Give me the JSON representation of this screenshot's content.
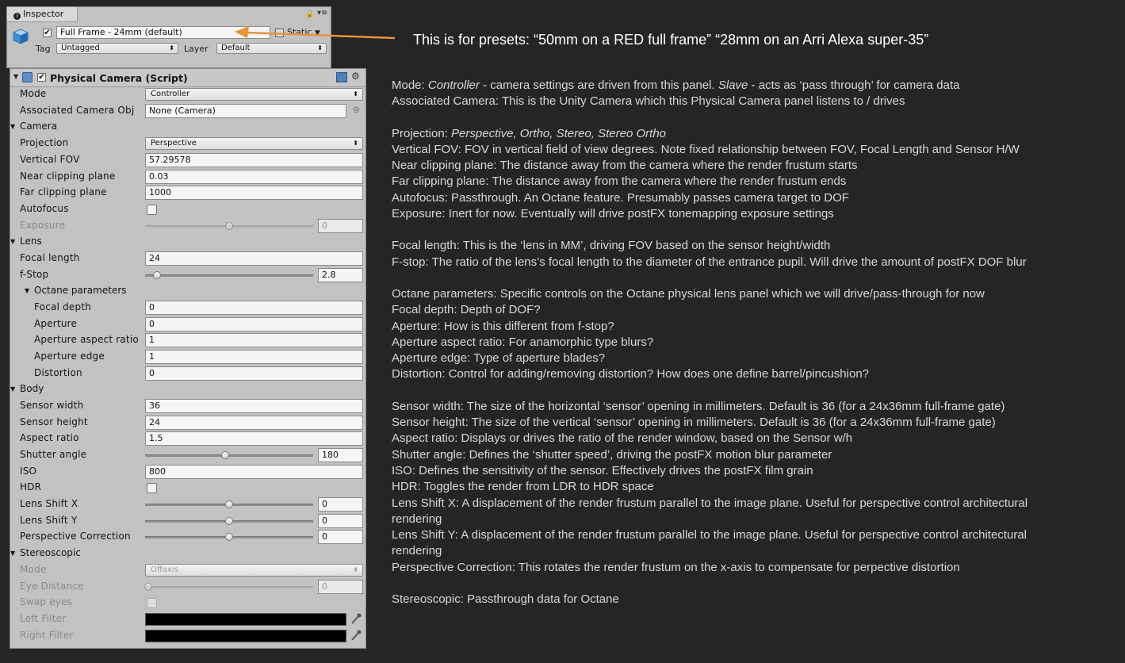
{
  "inspector": {
    "tab_label": "Inspector",
    "preset_name": "Full Frame - 24mm (default)",
    "preset_checked": true,
    "static_label": "Static",
    "tag_label": "Tag",
    "tag_value": "Untagged",
    "layer_label": "Layer",
    "layer_value": "Default"
  },
  "component": {
    "title": "Physical Camera (Script)",
    "mode_label": "Mode",
    "mode_value": "Controller",
    "assoc_label": "Associated Camera Obj",
    "assoc_value": "None (Camera)",
    "camera_section": "Camera",
    "projection_label": "Projection",
    "projection_value": "Perspective",
    "vfov_label": "Vertical FOV",
    "vfov_value": "57.29578",
    "near_label": "Near clipping plane",
    "near_value": "0.03",
    "far_label": "Far clipping plane",
    "far_value": "1000",
    "autofocus_label": "Autofocus",
    "exposure_label": "Exposure",
    "exposure_value": "0",
    "lens_section": "Lens",
    "focal_label": "Focal length",
    "focal_value": "24",
    "fstop_label": "f-Stop",
    "fstop_value": "2.8",
    "fstop_fraction": 0.05,
    "octane_section": "Octane parameters",
    "focal_depth_label": "Focal depth",
    "focal_depth_value": "0",
    "aperture_label": "Aperture",
    "aperture_value": "0",
    "aperture_ratio_label": "Aperture aspect ratio",
    "aperture_ratio_value": "1",
    "aperture_edge_label": "Aperture edge",
    "aperture_edge_value": "1",
    "distortion_label": "Distortion",
    "distortion_value": "0",
    "body_section": "Body",
    "sensor_w_label": "Sensor width",
    "sensor_w_value": "36",
    "sensor_h_label": "Sensor height",
    "sensor_h_value": "24",
    "aspect_label": "Aspect ratio",
    "aspect_value": "1.5",
    "shutter_label": "Shutter angle",
    "shutter_value": "180",
    "iso_label": "ISO",
    "iso_value": "800",
    "hdr_label": "HDR",
    "shiftx_label": "Lens Shift X",
    "shiftx_value": "0",
    "shifty_label": "Lens Shift Y",
    "shifty_value": "0",
    "persp_label": "Perspective Correction",
    "persp_value": "0",
    "stereo_section": "Stereoscopic",
    "stereo_mode_label": "Mode",
    "stereo_mode_value": "Offaxis",
    "eye_label": "Eye Distance",
    "eye_value": "0",
    "swap_label": "Swap eyes",
    "left_filter_label": "Left Filter",
    "right_filter_label": "Right Filter",
    "left_filter_color": "#000000",
    "right_filter_color": "#000000"
  },
  "annotation": {
    "arrow_color": "#e8923a",
    "preset_note": "This is for presets:  “50mm on a RED full frame” “28mm on an Arri Alexa super-35”",
    "mode_prefix": "Mode: ",
    "mode_controller": "Controller",
    "mode_mid": " - camera settings are driven from this panel.  ",
    "mode_slave": "Slave",
    "mode_suffix": " - acts as ‘pass through’ for camera data",
    "assoc": "Associated Camera: This is the Unity Camera which this Physical Camera panel listens to / drives",
    "proj_prefix": "Projection: ",
    "proj_values": "Perspective, Ortho, Stereo, Stereo Ortho",
    "vfov": "Vertical FOV:  FOV in vertical field of view degrees.  Note fixed relationship between FOV, Focal Length and Sensor H/W",
    "near": "Near clipping plane:  The distance away from the camera where the render frustum starts",
    "far": "Far clipping plane:  The distance away from the camera where the render frustum ends",
    "autofocus": "Autofocus:  Passthrough.  An Octane feature.  Presumably passes camera target to DOF",
    "exposure": "Exposure: Inert for now.  Eventually will drive postFX tonemapping exposure settings",
    "focal": "Focal length:  This is the ‘lens in MM’, driving FOV based on the sensor height/width",
    "fstop": "F-stop:  The ratio of the lens’s focal length to the diameter of the entrance pupil.  Will drive the amount of postFX DOF blur",
    "octane": "Octane parameters:  Specific controls on the Octane physical lens panel which we will drive/pass-through for now",
    "focal_depth": "Focal depth: Depth of DOF?",
    "aperture": "Aperture: How is this different from f-stop?",
    "aperture_ratio": "Aperture aspect ratio:  For anamorphic type blurs?",
    "aperture_edge": "Aperture edge: Type of aperture blades?",
    "distortion": "Distortion:  Control for adding/removing distortion?  How does one define barrel/pincushion?",
    "sensor_w": "Sensor width:  The size of the horizontal ‘sensor’ opening in millimeters.  Default is 36 (for a 24x36mm full-frame gate)",
    "sensor_h": "Sensor height: The size of the vertical ‘sensor’ opening in millimeters.  Default is 36 (for a 24x36mm full-frame gate)",
    "aspect": "Aspect ratio:  Displays or drives the ratio of the render window, based on the Sensor w/h",
    "shutter": "Shutter angle:  Defines the ‘shutter speed’, driving the postFX motion blur parameter",
    "iso": "ISO:  Defines the sensitivity of the sensor.  Effectively drives the postFX film grain",
    "hdr": "HDR:  Toggles the render from LDR to HDR space",
    "shiftx_1": "Lens Shift X:  A displacement of the render frustum parallel to the image plane.  Useful for perspective control architectural",
    "shiftx_2": "rendering",
    "shifty_1": "Lens Shift Y:  A displacement of the render frustum parallel to the image plane.  Useful for perspective control architectural",
    "shifty_2": "rendering",
    "persp": "Perspective Correction:  This rotates the render frustum on the x-axis to compensate for perpective distortion",
    "stereo": "Stereoscopic:  Passthrough data for Octane"
  }
}
